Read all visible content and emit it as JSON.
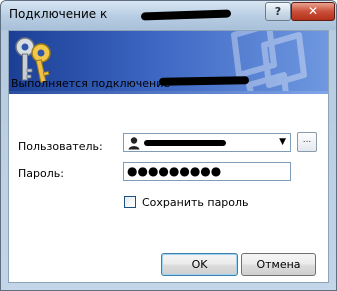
{
  "window": {
    "title": "Подключение к",
    "help_label": "?",
    "close_label": "✕"
  },
  "icons": {
    "banner": "keys-icon",
    "watermark": "computers-watermark-icon",
    "user": "user-icon",
    "dropdown": "chevron-down-icon"
  },
  "colors": {
    "banner_start": "#1b3f95",
    "banner_end": "#6f98e0",
    "close": "#c9503a"
  },
  "main": {
    "status_text": "Выполняется подключение"
  },
  "form": {
    "user_label": "Пользователь:",
    "password_label": "Пароль:",
    "password_value": "●●●●●●●●●",
    "browse_label": "...",
    "save_password_label": "Сохранить пароль",
    "save_password_checked": false
  },
  "buttons": {
    "ok_label": "OK",
    "cancel_label": "Отмена"
  }
}
